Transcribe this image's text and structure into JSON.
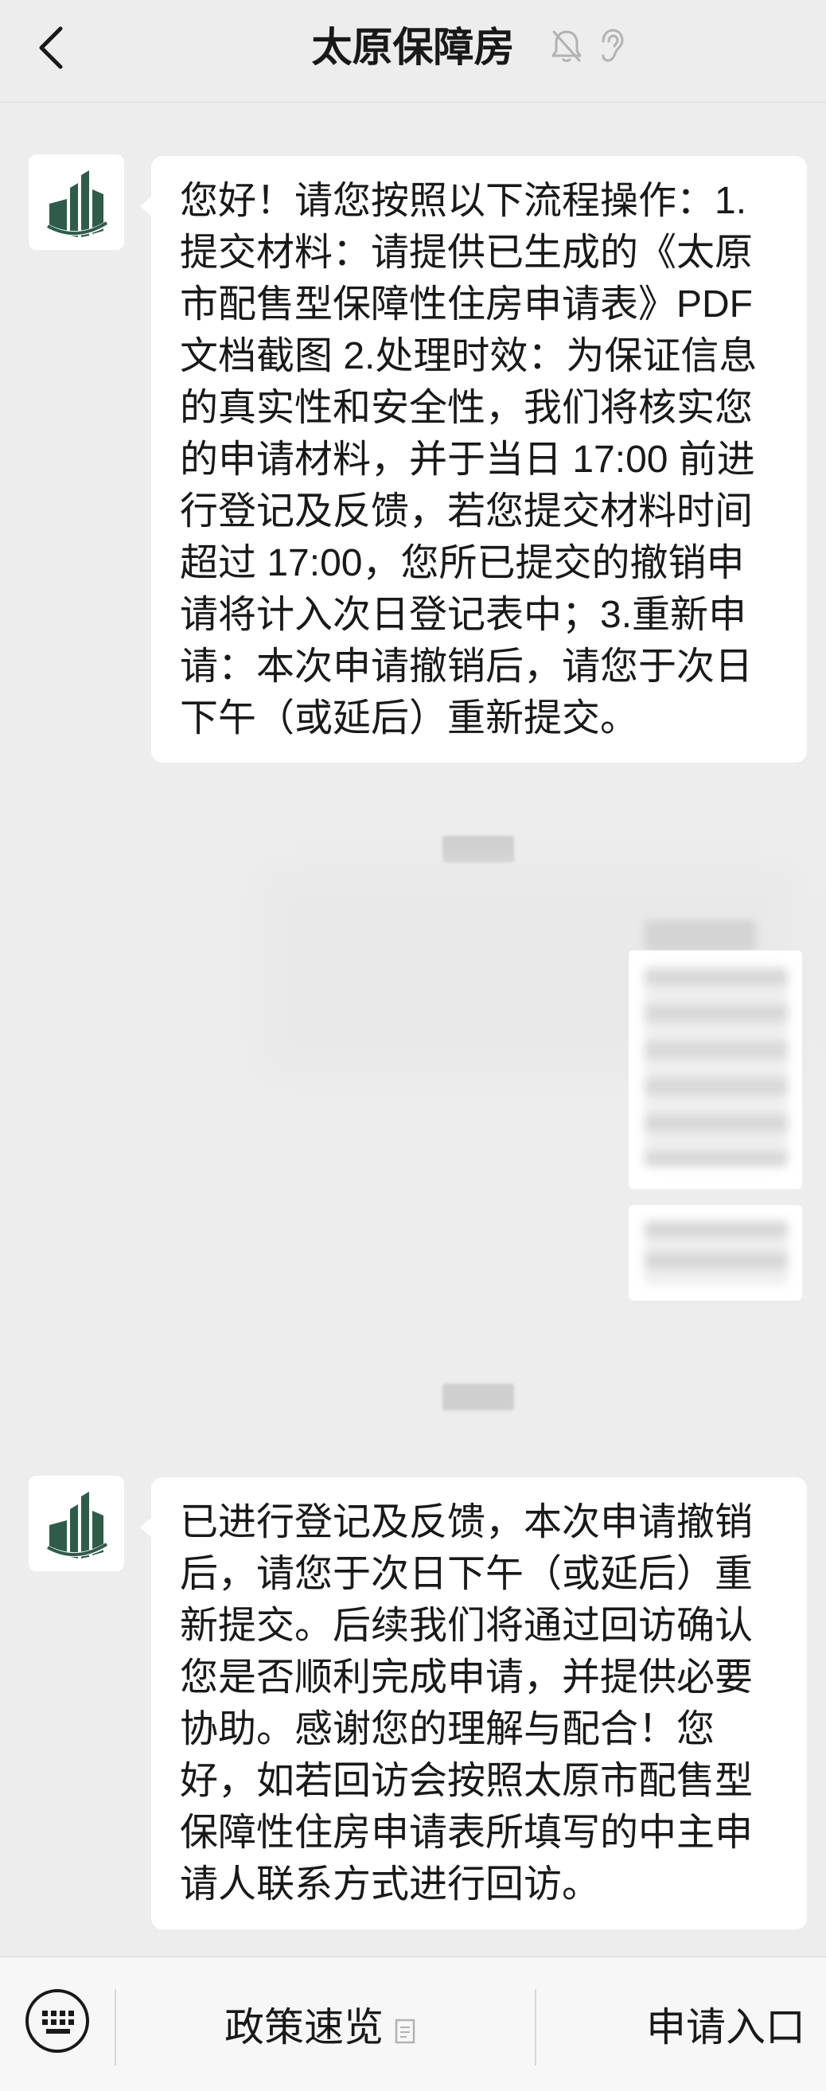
{
  "header": {
    "title": "太原保障房",
    "back_icon": "chevron-left-icon",
    "mute_icon": "bell-off-icon",
    "ear_icon": "ear-icon"
  },
  "messages": [
    {
      "sender": "official-account",
      "text": "您好！请您按照以下流程操作：1.提交材料：请提供已生成的《太原市配售型保障性住房申请表》PDF文档截图 2.处理时效：为保证信息的真实性和安全性，我们将核实您的申请材料，并于当日 17:00 前进行登记及反馈，若您提交材料时间超过 17:00，您所已提交的撤销申请将计入次日登记表中；3.重新申请：本次申请撤销后，请您于次日下午（或延后）重新提交。"
    },
    {
      "sender": "official-account",
      "text": "已进行登记及反馈，本次申请撤销后，请您于次日下午（或延后）重新提交。后续我们将通过回访确认您是否顺利完成申请，并提供必要协助。感谢您的理解与配合！您好，如若回访会按照太原市配售型保障性住房申请表所填写的中主申请人联系方式进行回访。"
    }
  ],
  "bottom_menu": {
    "keyboard_icon": "keyboard-icon",
    "item1_label": "政策速览",
    "item1_icon": "document-icon",
    "item2_label": "申请入口"
  },
  "colors": {
    "background": "#ededed",
    "bubble": "#ffffff",
    "logo_green": "#2f5c49"
  }
}
